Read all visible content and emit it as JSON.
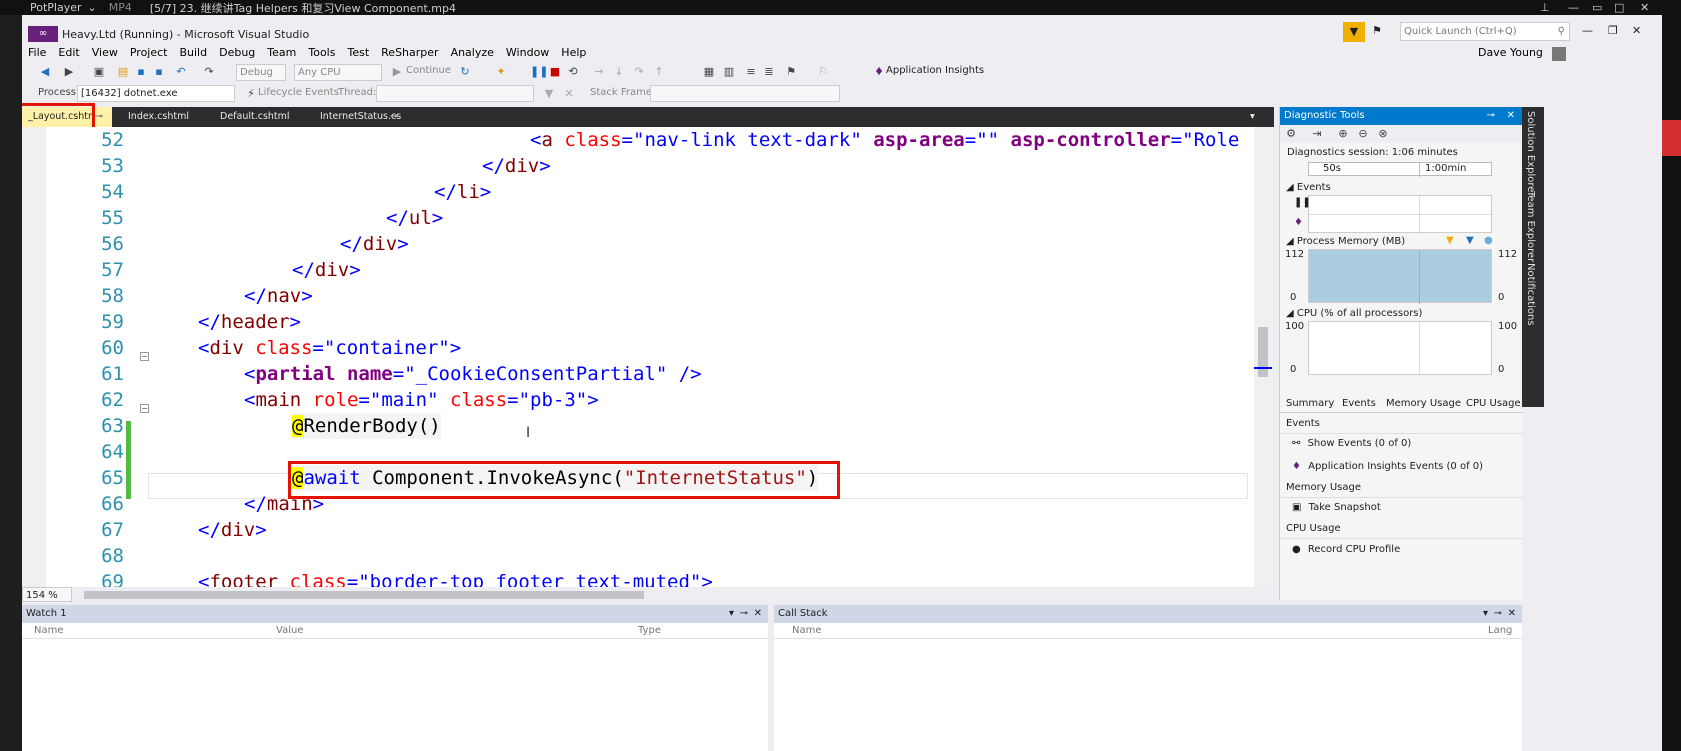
{
  "potplayer": {
    "app": "PotPlayer",
    "format": "MP4",
    "file_title": "[5/7] 23. 继续讲Tag Helpers 和复习View Component.mp4"
  },
  "window": {
    "title": "Heavy.Ltd (Running) - Microsoft Visual Studio",
    "quick_launch_placeholder": "Quick Launch (Ctrl+Q)",
    "user": "Dave Young"
  },
  "menu": [
    "File",
    "Edit",
    "View",
    "Project",
    "Build",
    "Debug",
    "Team",
    "Tools",
    "Test",
    "ReSharper",
    "Analyze",
    "Window",
    "Help"
  ],
  "toolbar": {
    "config": "Debug",
    "platform": "Any CPU",
    "continue": "Continue",
    "app_insights": "Application Insights"
  },
  "debugbar": {
    "process_label": "Process:",
    "process_value": "[16432] dotnet.exe",
    "lifecycle": "Lifecycle Events",
    "thread_label": "Thread:",
    "stack_label": "Stack Frame:"
  },
  "tabs": [
    {
      "label": "_Layout.cshtml"
    },
    {
      "label": "Index.cshtml"
    },
    {
      "label": "Default.cshtml"
    },
    {
      "label": "InternetStatus.cs"
    }
  ],
  "code": {
    "l52": {
      "n": "52",
      "text": "<a class=\"nav-link text-dark\" asp-area=\"\" asp-controller=\"Role"
    },
    "l53": {
      "n": "53",
      "text": "</div>"
    },
    "l54": {
      "n": "54",
      "text": "</li>"
    },
    "l55": {
      "n": "55",
      "text": "</ul>"
    },
    "l56": {
      "n": "56",
      "text": "</div>"
    },
    "l57": {
      "n": "57",
      "text": "</div>"
    },
    "l58": {
      "n": "58",
      "text": "</nav>"
    },
    "l59": {
      "n": "59",
      "text": "</header>"
    },
    "l60": {
      "n": "60",
      "text": "<div class=\"container\">"
    },
    "l61": {
      "n": "61",
      "text": "<partial name=\"_CookieConsentPartial\" />"
    },
    "l62": {
      "n": "62",
      "text": "<main role=\"main\" class=\"pb-3\">"
    },
    "l63": {
      "n": "63",
      "text": "@RenderBody()"
    },
    "l64": {
      "n": "64",
      "text": ""
    },
    "l65": {
      "n": "65",
      "text": "@await Component.InvokeAsync(\"InternetStatus\")"
    },
    "l66": {
      "n": "66",
      "text": "</main>"
    },
    "l67": {
      "n": "67",
      "text": "</div>"
    },
    "l68": {
      "n": "68",
      "text": ""
    },
    "l69": {
      "n": "69",
      "text": "<footer class=\"border-top footer text-muted\">"
    }
  },
  "zoom": "154 %",
  "diagnostic": {
    "title": "Diagnostic Tools",
    "session": "Diagnostics session: 1:06 minutes",
    "ruler_a": "50s",
    "ruler_b": "1:00min",
    "events": "Events",
    "memory_title": "Process Memory (MB)",
    "mem_max": "112",
    "mem_min": "0",
    "cpu_title": "CPU (% of all processors)",
    "cpu_max": "100",
    "cpu_min": "0",
    "tabs": [
      "Summary",
      "Events",
      "Memory Usage",
      "CPU Usage"
    ],
    "events_section": "Events",
    "show_events": "Show Events (0 of 0)",
    "ai_events": "Application Insights Events (0 of 0)",
    "memory_section": "Memory Usage",
    "take_snapshot": "Take Snapshot",
    "cpu_section": "CPU Usage",
    "record_cpu": "Record CPU Profile"
  },
  "side_tabs": [
    "Solution Explorer",
    "Team Explorer",
    "Notifications"
  ],
  "watch": {
    "title": "Watch 1",
    "columns": [
      "Name",
      "Value",
      "Type"
    ]
  },
  "callstack": {
    "title": "Call Stack",
    "columns": [
      "Name",
      "Lang"
    ]
  },
  "colors": {
    "accent": "#007acc",
    "highlight_box": "#e51400",
    "razor_yellow": "#ffff00"
  }
}
